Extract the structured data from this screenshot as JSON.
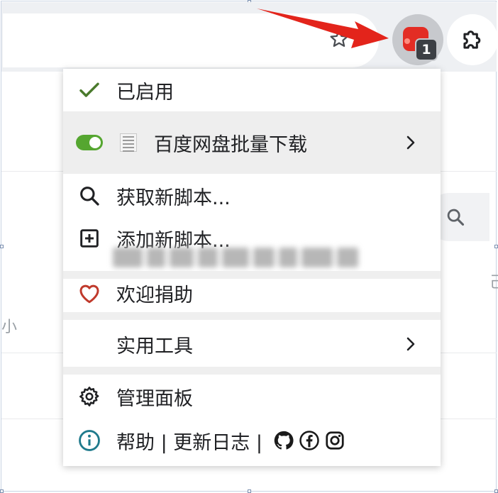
{
  "menu": {
    "enabled_label": "已启用",
    "script_name": "百度网盘批量下载",
    "get_new_scripts": "获取新脚本...",
    "add_new_script": "添加新脚本...",
    "donate": "欢迎捐助",
    "utilities": "实用工具",
    "dashboard": "管理面板",
    "help_changelog": "帮助 | 更新日志 |"
  },
  "toolbar": {
    "extension_badge": "1"
  },
  "background_page": {
    "left_fragment": "小",
    "right_fragment": "己"
  },
  "colors": {
    "check": "#4a7a2c",
    "toggle_on": "#55a630",
    "heart": "#c0392b",
    "info": "#1f7a8c",
    "arrow": "#e3241b",
    "extension_icon": "#e32d24"
  },
  "icons": [
    "check-icon",
    "toggle-icon",
    "script-favicon",
    "chevron-right-icon",
    "search-icon",
    "plus-square-icon",
    "heart-icon",
    "gear-icon",
    "info-icon",
    "github-icon",
    "facebook-icon",
    "instagram-icon",
    "star-icon",
    "puzzle-icon",
    "red-arrow"
  ]
}
